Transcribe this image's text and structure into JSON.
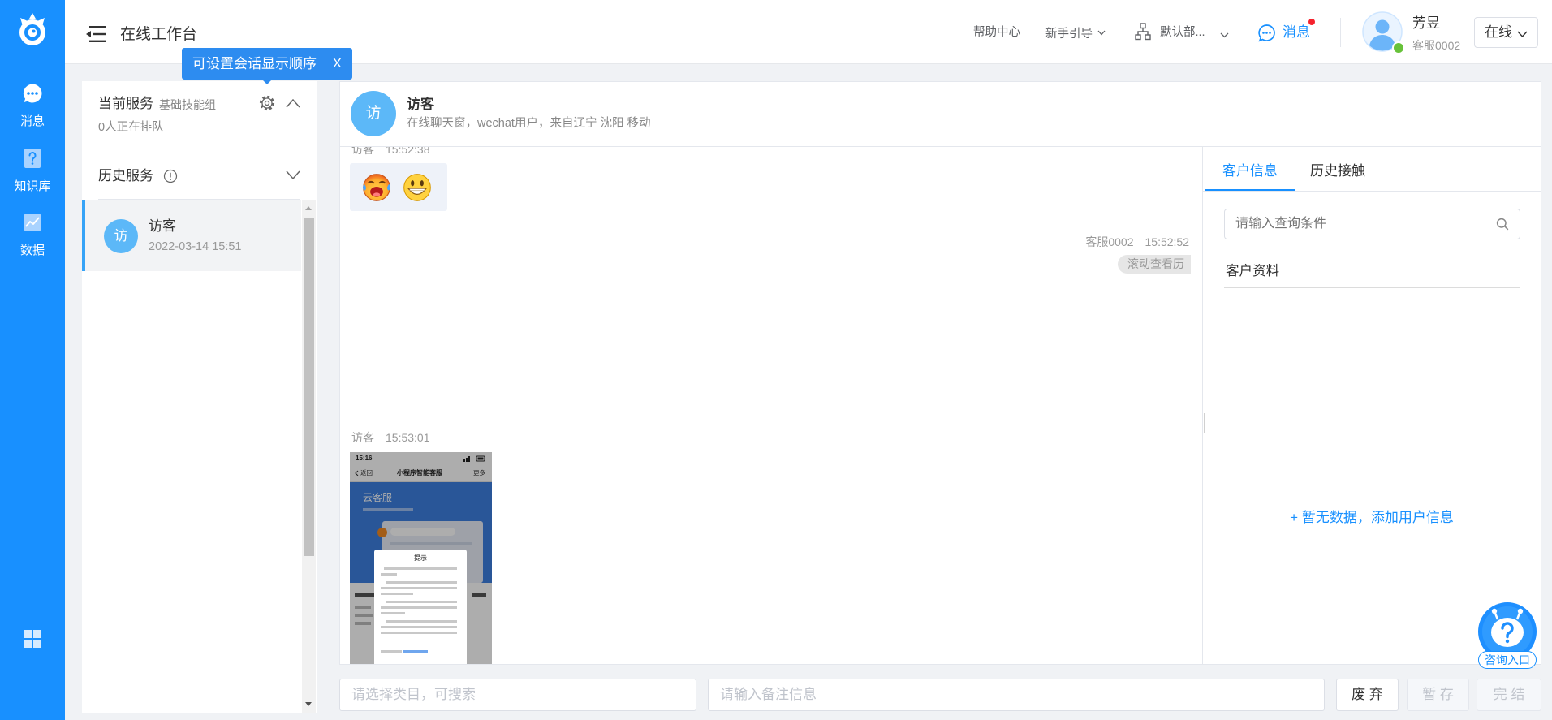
{
  "app": {
    "title": "在线工作台"
  },
  "theme": {
    "primary": "#1890ff",
    "avatar_bg": "#5cb8f8",
    "online_dot": "#67c23a",
    "badge_dot": "#f5222d"
  },
  "sidebar": {
    "logo": "app-logo-icon",
    "items": [
      {
        "label": "消息",
        "icon": "chat-bubble-icon",
        "active": true
      },
      {
        "label": "知识库",
        "icon": "question-book-icon",
        "active": false
      },
      {
        "label": "数据",
        "icon": "line-chart-icon",
        "active": false
      }
    ],
    "bottom_icon": "grid-apps-icon"
  },
  "header": {
    "menu_icon": "menu-fold-icon",
    "help": "帮助中心",
    "guide": "新手引导",
    "department": "默认部...",
    "messages": "消息",
    "messages_unread": true,
    "user": {
      "name": "芳昱",
      "id": "客服0002",
      "online": true
    },
    "status": "在线"
  },
  "tooltip": {
    "text": "可设置会话显示顺序",
    "close": "X"
  },
  "session_panel": {
    "current": {
      "title": "当前服务",
      "group": "基础技能组",
      "queue": "0人正在排队"
    },
    "history": {
      "title": "历史服务"
    },
    "sessions": [
      {
        "avatar": "访",
        "name": "访客",
        "time": "2022-03-14 15:51",
        "selected": true
      }
    ]
  },
  "chat": {
    "avatar": "访",
    "visitor": "访客",
    "subtitle": "在线聊天窗，wechat用户，来自辽宁 沈阳 移动",
    "messages": [
      {
        "sender": "访客",
        "time": "15:52:38",
        "emojis": [
          "emoji-laughing-tears-icon",
          "emoji-grinning-icon"
        ]
      },
      {
        "sender": "客服0002",
        "time": "15:52:52",
        "notice": "滚动查看历"
      },
      {
        "sender": "访客",
        "time": "15:53:01",
        "image": {
          "status_time": "15:16",
          "back": "返回",
          "title": "小程序智能客服",
          "more": "更多",
          "banner": "云客服",
          "dialog_title": "提示"
        }
      }
    ]
  },
  "customer_panel": {
    "tabs": [
      {
        "label": "客户信息",
        "active": true
      },
      {
        "label": "历史接触",
        "active": false
      }
    ],
    "search_placeholder": "请输入查询条件",
    "section_title": "客户资料",
    "empty_action": "+ 暂无数据，添加用户信息"
  },
  "help_widget": {
    "label": "咨询入口",
    "icon": "robot-help-icon"
  },
  "footer": {
    "category_placeholder": "请选择类目，可搜索",
    "note_placeholder": "请输入备注信息",
    "buttons": [
      {
        "label": "废 弃",
        "enabled": true
      },
      {
        "label": "暂 存",
        "enabled": false
      },
      {
        "label": "完 结",
        "enabled": false
      }
    ]
  }
}
